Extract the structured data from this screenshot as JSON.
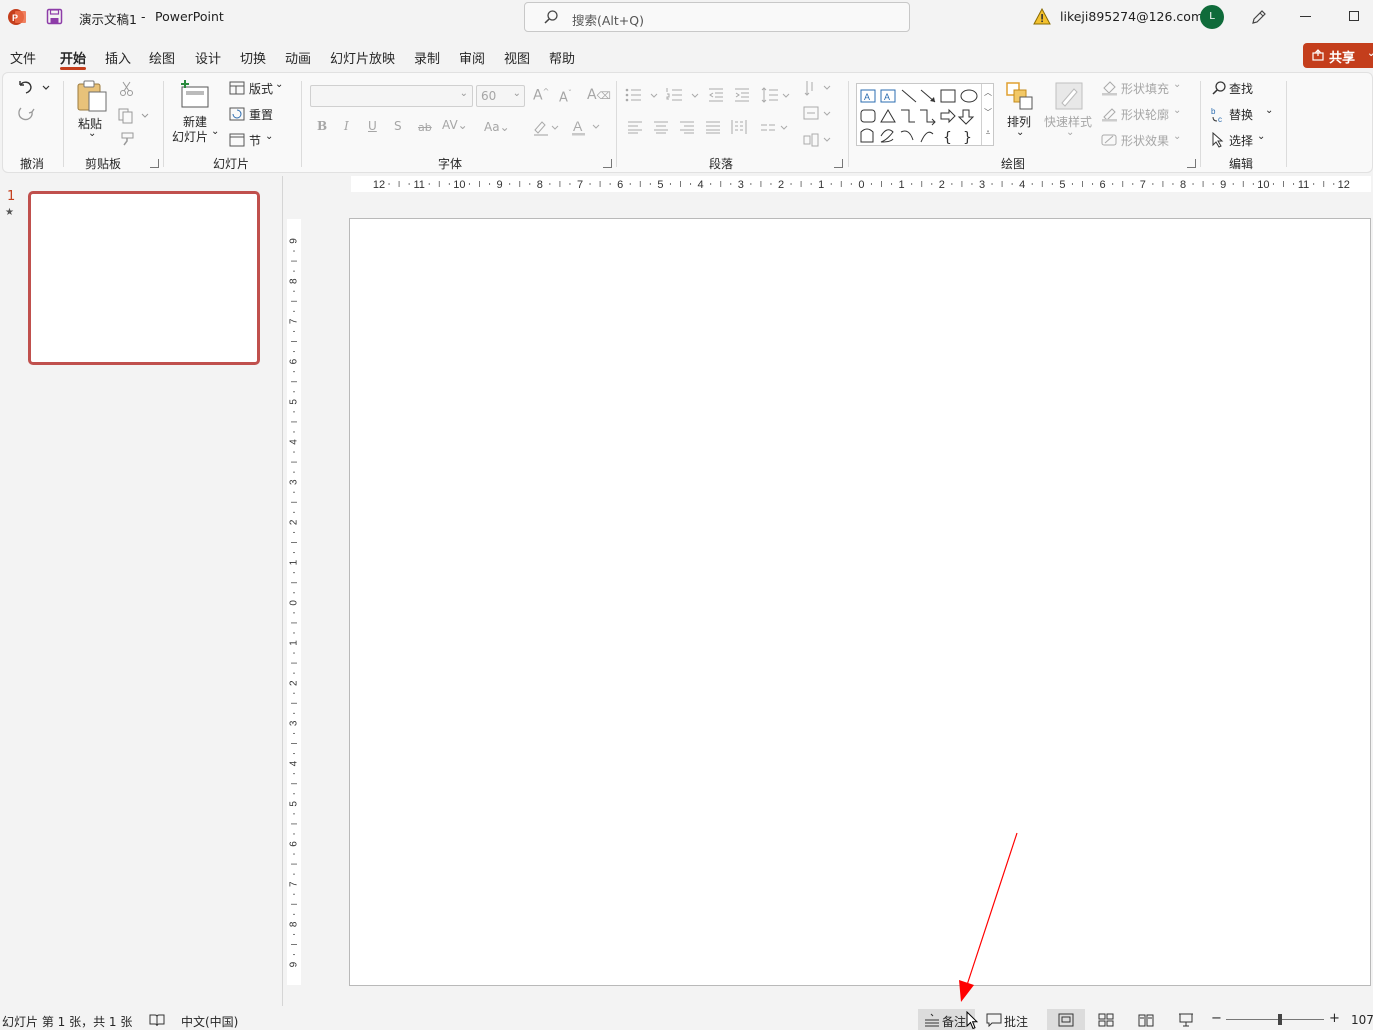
{
  "titlebar": {
    "app_icon": "powerpoint-logo-icon",
    "save_icon": "save-icon",
    "doc_title": "演示文稿1",
    "separator": "-",
    "app_name": "PowerPoint",
    "search_placeholder": "搜索(Alt+Q)",
    "warning_icon": "warning-icon",
    "account": "likeji895274@126.com",
    "avatar_letter": "L",
    "pen_icon": "pen-icon",
    "minimize_icon": "minimize-icon",
    "maximize_icon": "maximize-icon"
  },
  "menu": {
    "tabs": [
      "文件",
      "开始",
      "插入",
      "绘图",
      "设计",
      "切换",
      "动画",
      "幻灯片放映",
      "录制",
      "审阅",
      "视图",
      "帮助"
    ],
    "active_index": 1,
    "share_label": "共享"
  },
  "ribbon": {
    "undo_group": {
      "label": "撤消"
    },
    "clipboard": {
      "label": "剪贴板",
      "paste": "粘贴"
    },
    "slides": {
      "label": "幻灯片",
      "new_line1": "新建",
      "new_line2": "幻灯片",
      "layout": "版式",
      "reset": "重置",
      "section": "节"
    },
    "font": {
      "label": "字体",
      "size_value": "60"
    },
    "paragraph": {
      "label": "段落"
    },
    "drawing": {
      "label": "绘图",
      "arrange": "排列",
      "quick_styles": "快速样式",
      "shape_fill": "形状填充",
      "shape_outline": "形状轮廓",
      "shape_effects": "形状效果"
    },
    "editing": {
      "label": "编辑",
      "find": "查找",
      "replace": "替换",
      "select": "选择"
    }
  },
  "slide_pane": {
    "slide_number": "1",
    "star": "★"
  },
  "rulers": {
    "horizontal_ticks": [
      "12",
      "11",
      "10",
      "9",
      "8",
      "7",
      "6",
      "5",
      "4",
      "3",
      "2",
      "1",
      "0",
      "1",
      "2",
      "3",
      "4",
      "5",
      "6",
      "7",
      "8",
      "9",
      "10",
      "11",
      "12"
    ],
    "vertical_ticks": [
      "9",
      "8",
      "7",
      "6",
      "5",
      "4",
      "3",
      "2",
      "1",
      "0",
      "1",
      "2",
      "3",
      "4",
      "5",
      "6",
      "7",
      "8",
      "9"
    ]
  },
  "statusbar": {
    "slide_info": "幻灯片 第 1 张，共 1 张",
    "language": "中文(中国)",
    "notes": "备注",
    "comments": "批注",
    "zoom_minus": "−",
    "zoom_plus": "+",
    "zoom_level": "107",
    "zoom_fraction": 0.55
  },
  "colors": {
    "accent": "#c43e1c",
    "ribbon_bg": "#f9f9f9",
    "annotation_arrow": "#ff0000"
  }
}
